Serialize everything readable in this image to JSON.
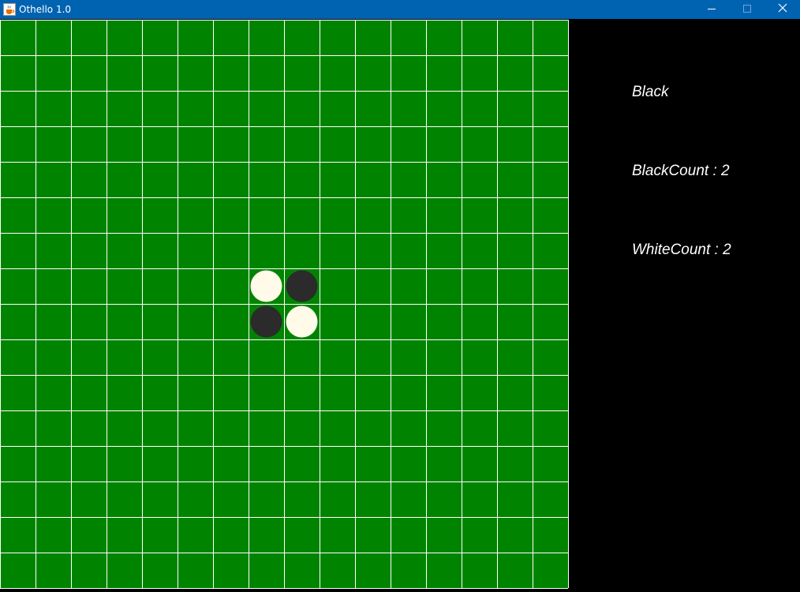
{
  "window": {
    "title": "Othello 1.0",
    "app_icon": "java-cup-icon",
    "controls": [
      "minimize-icon",
      "maximize-icon",
      "close-icon"
    ],
    "titlebar_color": "#0063b1"
  },
  "board": {
    "rows": 16,
    "cols": 16,
    "background_color": "#008400",
    "grid_color": "#ffffff",
    "pieces": [
      {
        "row": 7,
        "col": 7,
        "color": "white"
      },
      {
        "row": 7,
        "col": 8,
        "color": "black"
      },
      {
        "row": 8,
        "col": 7,
        "color": "black"
      },
      {
        "row": 8,
        "col": 8,
        "color": "white"
      }
    ],
    "piece_colors": {
      "white": "#fffbe8",
      "black": "#2b2b2b"
    }
  },
  "status": {
    "turn": "Black",
    "black_count": "BlackCount : 2",
    "white_count": "WhiteCount : 2"
  }
}
